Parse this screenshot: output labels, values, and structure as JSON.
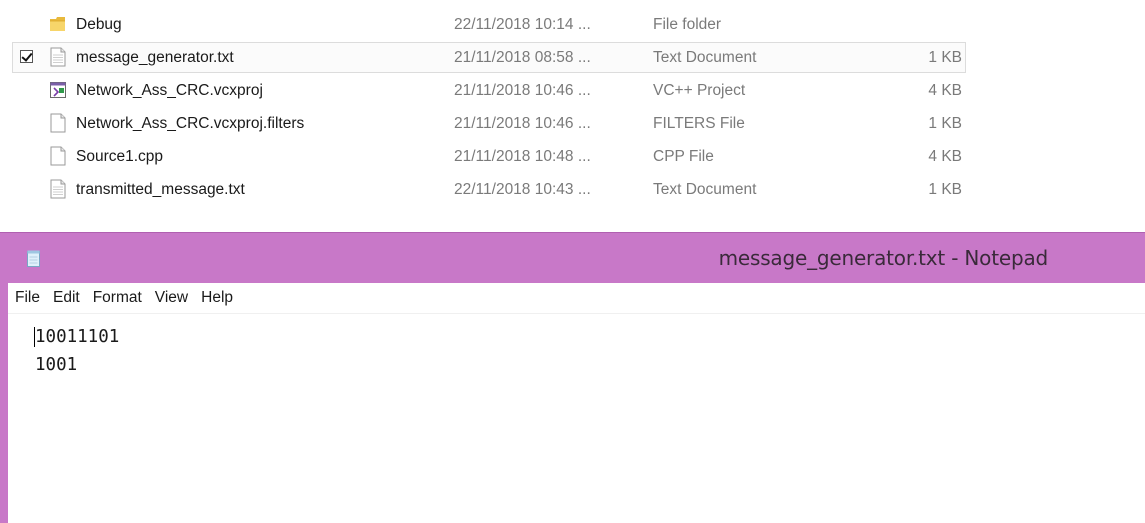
{
  "explorer": {
    "files": [
      {
        "name": "Debug",
        "date": "22/11/2018 10:14 ...",
        "type": "File folder",
        "size": "",
        "icon": "folder-icon",
        "selected": false
      },
      {
        "name": "message_generator.txt",
        "date": "21/11/2018 08:58 ...",
        "type": "Text Document",
        "size": "1 KB",
        "icon": "text-file-icon",
        "selected": true
      },
      {
        "name": "Network_Ass_CRC.vcxproj",
        "date": "21/11/2018 10:46 ...",
        "type": "VC++ Project",
        "size": "4 KB",
        "icon": "vcxproj-icon",
        "selected": false
      },
      {
        "name": "Network_Ass_CRC.vcxproj.filters",
        "date": "21/11/2018 10:46 ...",
        "type": "FILTERS File",
        "size": "1 KB",
        "icon": "generic-file-icon",
        "selected": false
      },
      {
        "name": "Source1.cpp",
        "date": "21/11/2018 10:48 ...",
        "type": "CPP File",
        "size": "4 KB",
        "icon": "generic-file-icon",
        "selected": false
      },
      {
        "name": "transmitted_message.txt",
        "date": "22/11/2018 10:43 ...",
        "type": "Text Document",
        "size": "1 KB",
        "icon": "text-file-icon",
        "selected": false
      }
    ]
  },
  "notepad": {
    "title": "message_generator.txt - Notepad",
    "menu": [
      "File",
      "Edit",
      "Format",
      "View",
      "Help"
    ],
    "content": "10011101\n1001",
    "titlebar_color": "#c878c8"
  }
}
